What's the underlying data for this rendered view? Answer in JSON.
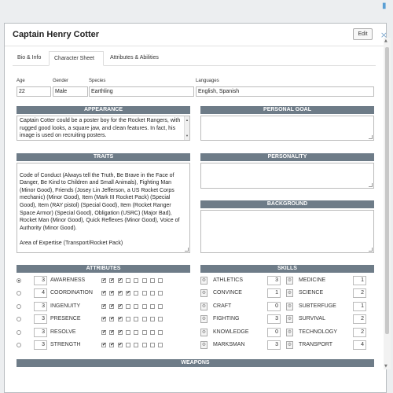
{
  "window": {
    "title": "Captain Henry Cotter",
    "edit_label": "Edit",
    "close_glyph": "×"
  },
  "tabs": [
    {
      "label": "Bio & Info",
      "active": false
    },
    {
      "label": "Character Sheet",
      "active": true
    },
    {
      "label": "Attributes & Abilities",
      "active": false
    }
  ],
  "bio": {
    "age_label": "Age",
    "age": "22",
    "gender_label": "Gender",
    "gender": "Male",
    "species_label": "Species",
    "species": "Earthling",
    "languages_label": "Languages",
    "languages": "English, Spanish"
  },
  "sections": {
    "appearance": "APPEARANCE",
    "personal_goal": "PERSONAL GOAL",
    "traits": "TRAITS",
    "personality": "PERSONALITY",
    "background": "BACKGROUND",
    "attributes": "ATTRIBUTES",
    "skills": "SKILLS",
    "weapons": "WEAPONS"
  },
  "appearance_text": "Captain Cotter could be a poster boy for the Rocket Rangers, with rugged good looks, a square jaw, and clean features. In fact, his image is used on recruiting posters.",
  "traits_text": "Code of Conduct (Always tell the Truth, Be Brave in the Face of Danger, Be Kind to Children and Small Animals), Fighting Man (Minor Good), Friends (Josey Lin Jefferson, a US Rocket Corps mechanic) (Minor Good), Item (Mark III Rocket Pack) (Special Good), Item (RAY pistol) (Special Good), Item (Rocket Ranger Space Armor) (Special Good), Obligation (USRC) (Major Bad), Rocket Man (Minor Good), Quick Reflexes (Minor Good), Voice of Authority (Minor Good).\n\nArea of Expertise (Transport/Rocket Pack)",
  "personal_goal_text": "",
  "personality_text": "",
  "background_text": "",
  "attributes": [
    {
      "name": "AWARENESS",
      "value": "3",
      "selected": true,
      "checks": 3
    },
    {
      "name": "COORDINATION",
      "value": "4",
      "selected": false,
      "checks": 4
    },
    {
      "name": "INGENUITY",
      "value": "3",
      "selected": false,
      "checks": 3
    },
    {
      "name": "PRESENCE",
      "value": "3",
      "selected": false,
      "checks": 3
    },
    {
      "name": "RESOLVE",
      "value": "3",
      "selected": false,
      "checks": 3
    },
    {
      "name": "STRENGTH",
      "value": "3",
      "selected": false,
      "checks": 3
    }
  ],
  "skills_left": [
    {
      "name": "ATHLETICS",
      "value": "3"
    },
    {
      "name": "CONVINCE",
      "value": "1"
    },
    {
      "name": "CRAFT",
      "value": "0"
    },
    {
      "name": "FIGHTING",
      "value": "3"
    },
    {
      "name": "KNOWLEDGE",
      "value": "0"
    },
    {
      "name": "MARKSMAN",
      "value": "3"
    }
  ],
  "skills_right": [
    {
      "name": "MEDICINE",
      "value": "1"
    },
    {
      "name": "SCIENCE",
      "value": "2"
    },
    {
      "name": "SUBTERFUGE",
      "value": "1"
    },
    {
      "name": "SURVIVAL",
      "value": "2"
    },
    {
      "name": "TECHNOLOGY",
      "value": "2"
    },
    {
      "name": "TRANSPORT",
      "value": "4"
    }
  ],
  "icons": {
    "checkbox_checked": "✔",
    "skill_icon": "⚙",
    "corner": "bookmark-icon"
  }
}
